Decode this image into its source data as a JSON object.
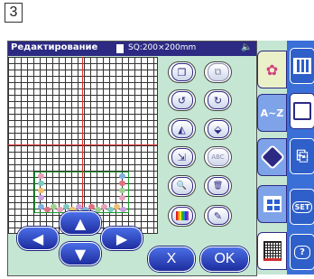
{
  "step_number": "3",
  "titlebar": {
    "title": "Редактирование",
    "hoop_size": "SQ:200×200mm",
    "speaker_icon": "speaker-icon"
  },
  "edit_buttons": [
    {
      "name": "copy-button",
      "icon": "copy-icon",
      "symbol": "❐"
    },
    {
      "name": "duplicate-button",
      "icon": "duplicate-icon",
      "symbol": "⧉"
    },
    {
      "name": "rotate-left-button",
      "icon": "rotate-ccw-icon",
      "symbol": "↺"
    },
    {
      "name": "rotate-right-button",
      "icon": "rotate-cw-icon",
      "symbol": "↻"
    },
    {
      "name": "mirror-horizontal-button",
      "icon": "mirror-horizontal-icon",
      "symbol": "◭"
    },
    {
      "name": "mirror-vertical-button",
      "icon": "mirror-vertical-icon",
      "symbol": "⬙"
    },
    {
      "name": "resize-button",
      "icon": "resize-icon",
      "symbol": "⇲"
    },
    {
      "name": "arc-text-button",
      "icon": "arc-text-icon",
      "symbol": "ABC"
    },
    {
      "name": "zoom-button",
      "icon": "magnifier-icon",
      "symbol": "🔍"
    },
    {
      "name": "trash-button",
      "icon": "trash-icon",
      "symbol": "🗑"
    },
    {
      "name": "color-button",
      "icon": "color-palette-icon",
      "symbol": ""
    },
    {
      "name": "save-button",
      "icon": "save-icon",
      "symbol": "✎"
    }
  ],
  "arrows": {
    "up": "▲",
    "left": "◀",
    "right": "▶",
    "down": "▼"
  },
  "actions": {
    "cancel_label": "X",
    "ok_label": "OK"
  },
  "tabs": [
    {
      "name": "tab-built-in-designs",
      "label": "",
      "icon": "flower-icon"
    },
    {
      "name": "tab-lettering",
      "label": "A~Z",
      "icon": ""
    },
    {
      "name": "tab-my-designs",
      "label": "",
      "icon": "diamond-icon"
    },
    {
      "name": "tab-grid-layout",
      "label": "",
      "icon": "grid-icon"
    },
    {
      "name": "tab-edit",
      "label": "",
      "icon": "grid-view-icon"
    }
  ],
  "right_buttons": [
    {
      "name": "edit-mode-button",
      "label": "",
      "icon": "edit-mode-icon"
    },
    {
      "name": "embroidery-mode-button",
      "label": "",
      "icon": "embroidery-icon"
    },
    {
      "name": "save-file-button",
      "label": "",
      "icon": "file-icon"
    },
    {
      "name": "set-button",
      "label": "SET",
      "icon": ""
    },
    {
      "name": "help-button",
      "label": "?",
      "icon": ""
    }
  ],
  "colors": {
    "panel_bg": "#c5e6d3",
    "titlebar": "#2d2a84",
    "button_blue": "#2d4fc4",
    "guide_red": "#e03030",
    "frame_green": "#1a9a2a"
  }
}
